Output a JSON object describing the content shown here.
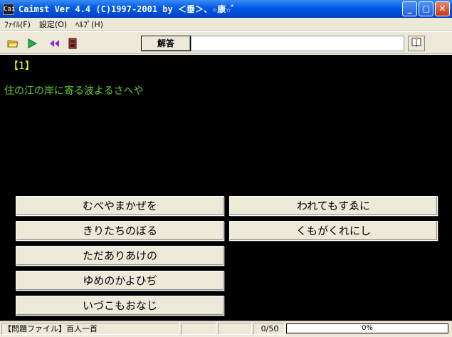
{
  "window": {
    "title": "Caimst Ver 4.4 (C)1997-2001  by ＜垂＞、☆康☆ﾞ",
    "app_icon": "Cai",
    "minimize": "_",
    "maximize": "□",
    "close": "✕"
  },
  "menu": [
    {
      "label": "ﾌｧｲﾙ(F)"
    },
    {
      "label": "設定(O)"
    },
    {
      "label": "ﾍﾙﾌﾟ(H)"
    }
  ],
  "toolbar": {
    "icons": [
      "open-folder-icon",
      "play-icon",
      "rewind-icon",
      "stop-icon"
    ],
    "answer_label": "解答",
    "answer_value": "",
    "help_icon": "book-icon"
  },
  "main": {
    "question_number": "【1】",
    "question_text": "住の江の岸に寄る波よるさへや",
    "choices_left": [
      "むべやまかぜを",
      "きりたちのぼる",
      "ただありあけの",
      "ゆめのかよひぢ",
      "いづこもおなじ"
    ],
    "choices_right": [
      "われてもすゑに",
      "くもがくれにし"
    ]
  },
  "status": {
    "file_label": "【問題ファイル】百人一首",
    "count": "0/50",
    "progress_text": "0%",
    "progress_value": 0
  },
  "colors": {
    "question_number": "#ffff00",
    "question_text": "#66cc33",
    "background": "#000000"
  }
}
